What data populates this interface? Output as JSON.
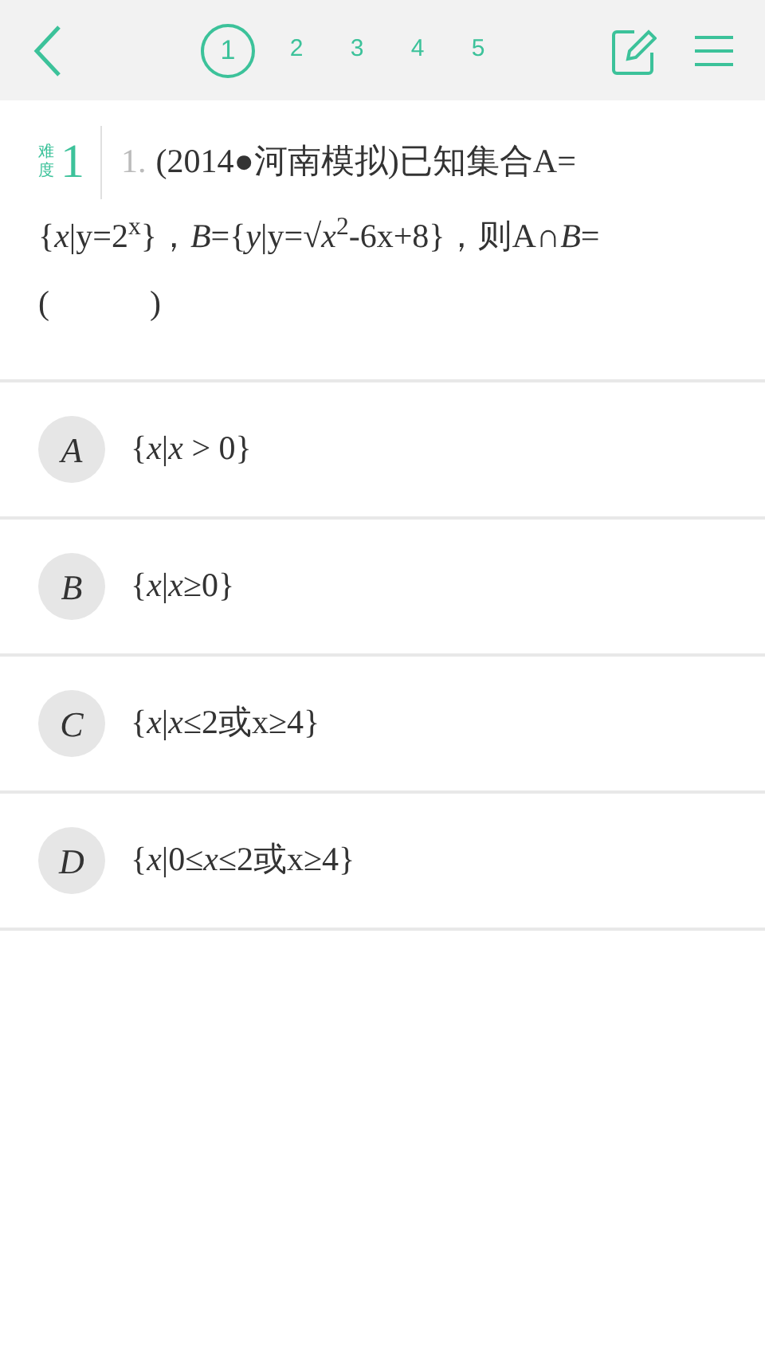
{
  "pages": [
    {
      "label": "1",
      "selected": true
    },
    {
      "label": "2",
      "selected": false
    },
    {
      "label": "3",
      "selected": false
    },
    {
      "label": "4",
      "selected": false
    },
    {
      "label": "5",
      "selected": false
    }
  ],
  "difficulty": {
    "label": "难度",
    "value": "1"
  },
  "question": {
    "number": "1.",
    "lines": [
      "(2014●河南模拟)已知集合A=",
      "{*x*|y=2$^{x}$}，*B*={*y*|y=√*x*$^{2}$-6x+8}，则A∩*B*=\n(　　　)"
    ]
  },
  "options": [
    {
      "letter": "A",
      "text": "{*x*|*x* > 0}"
    },
    {
      "letter": "B",
      "text": "{*x*|*x*≥0}"
    },
    {
      "letter": "C",
      "text": "{*x*|*x*≤2或x≥4}"
    },
    {
      "letter": "D",
      "text": "{*x*|0≤*x*≤2或x≥4}"
    }
  ]
}
